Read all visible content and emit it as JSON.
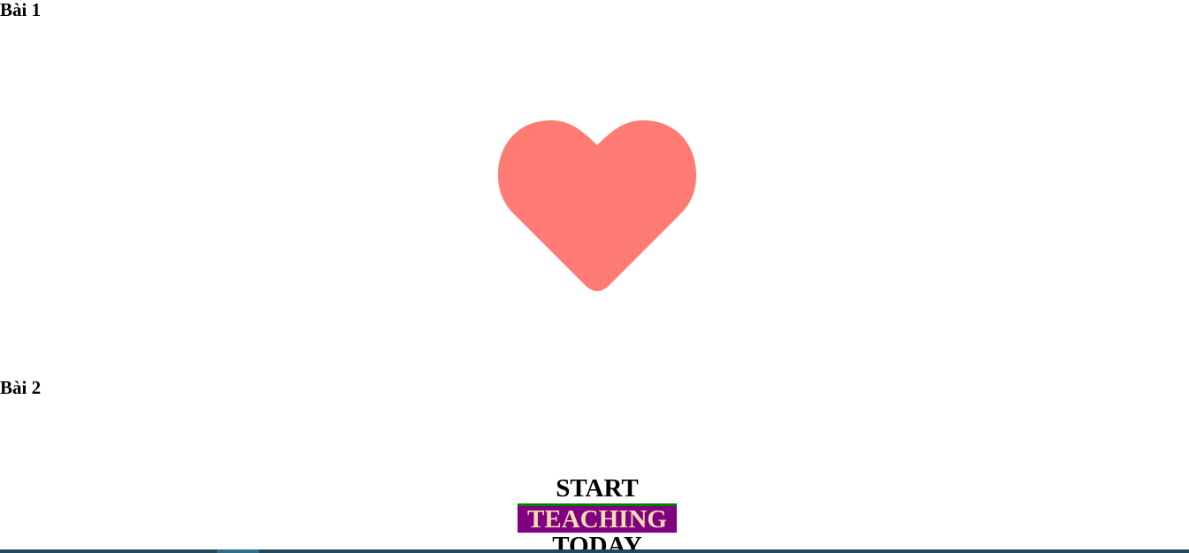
{
  "sections": {
    "first": {
      "heading": "Bài 1"
    },
    "second": {
      "heading": "Bài 2"
    }
  },
  "heart": {
    "icon": "heart-icon",
    "color": "#ff7b73"
  },
  "text_stack": {
    "line1": "START",
    "line2": "TEACHING",
    "line3": "TODAY",
    "colors": {
      "teaching_background": "#800080",
      "teaching_text": "#f5deb3",
      "teaching_border": "#008000"
    }
  }
}
